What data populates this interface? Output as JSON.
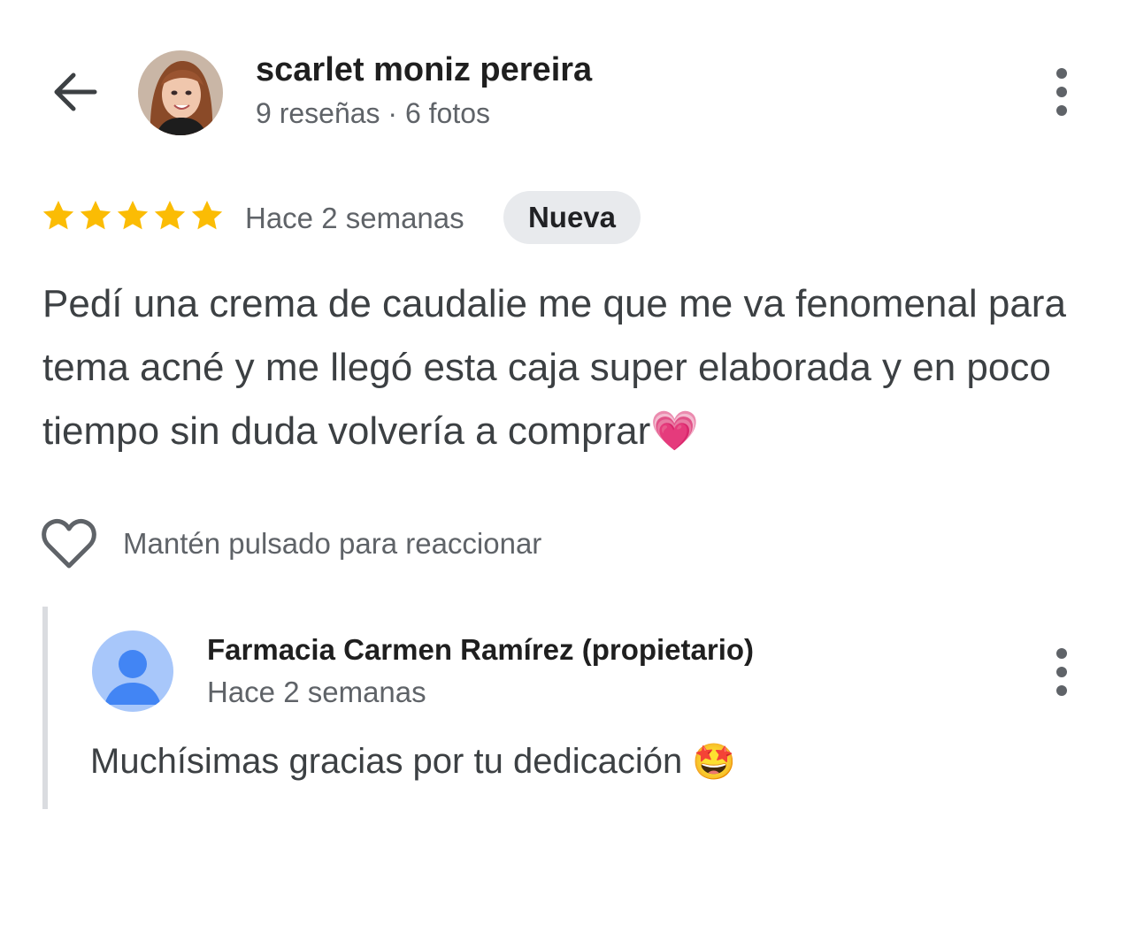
{
  "header": {
    "reviewer_name": "scarlet moniz pereira",
    "reviewer_meta": "9 reseñas · 6 fotos",
    "back_icon": "arrow-back-icon",
    "more_icon": "more-vert-icon"
  },
  "review": {
    "rating": 5,
    "rating_max": 5,
    "date": "Hace 2 semanas",
    "badge": "Nueva",
    "text": "Pedí una crema de caudalie me que me va fenomenal para tema acné y me llegó esta caja super elaborada y en poco tiempo sin duda volvería a comprar",
    "emoji": "💗"
  },
  "reaction": {
    "hint": "Mantén pulsado para reaccionar",
    "icon": "heart-outline-icon"
  },
  "owner_reply": {
    "name": "Farmacia Carmen Ramírez (propietario)",
    "date": "Hace 2 semanas",
    "text": "Muchísimas gracias por tu dedicación",
    "emoji": "🤩",
    "avatar_icon": "person-icon"
  },
  "colors": {
    "star": "#fbbc04",
    "secondary_text": "#5f6368",
    "badge_bg": "#e8eaed",
    "owner_avatar_bg": "#a8c7fa",
    "owner_avatar_fg": "#4285f4"
  }
}
